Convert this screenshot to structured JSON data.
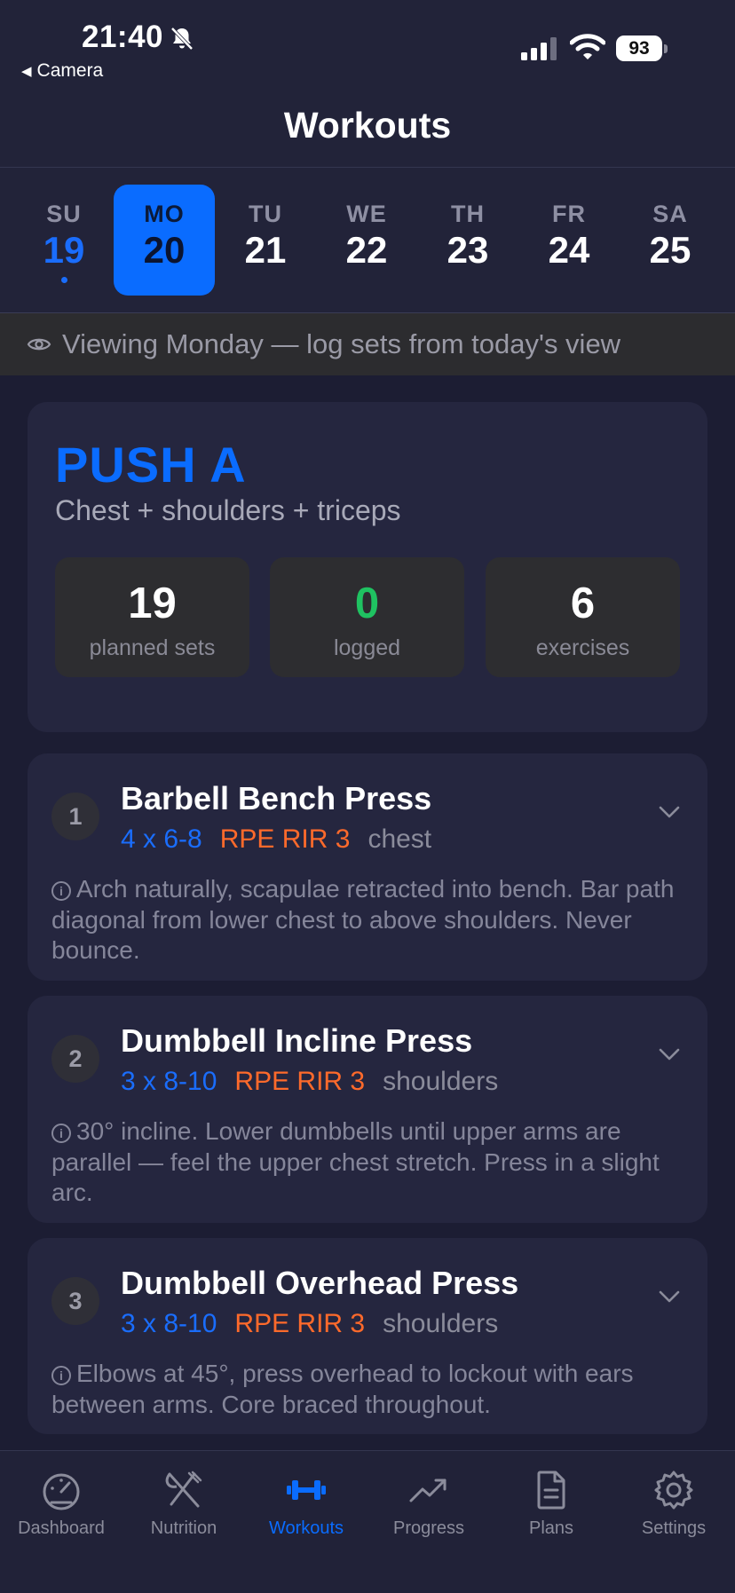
{
  "status_bar": {
    "time": "21:40",
    "back_app": "Camera",
    "battery": "93"
  },
  "header": {
    "title": "Workouts"
  },
  "week": {
    "days": [
      {
        "name": "SU",
        "date": "19",
        "state": "today"
      },
      {
        "name": "MO",
        "date": "20",
        "state": "selected"
      },
      {
        "name": "TU",
        "date": "21",
        "state": "normal"
      },
      {
        "name": "WE",
        "date": "22",
        "state": "normal"
      },
      {
        "name": "TH",
        "date": "23",
        "state": "normal"
      },
      {
        "name": "FR",
        "date": "24",
        "state": "normal"
      },
      {
        "name": "SA",
        "date": "25",
        "state": "normal"
      }
    ]
  },
  "banner": {
    "text": "Viewing Monday — log sets from today's view",
    "icon": "eye-icon"
  },
  "summary": {
    "title": "PUSH A",
    "subtitle": "Chest + shoulders + triceps",
    "stats": [
      {
        "value": "19",
        "label": "planned sets"
      },
      {
        "value": "0",
        "label": "logged"
      },
      {
        "value": "6",
        "label": "exercises"
      }
    ]
  },
  "exercises": [
    {
      "number": "1",
      "name": "Barbell Bench Press",
      "sets_reps": "4 x 6-8",
      "rpe": "RPE RIR 3",
      "muscle": "chest",
      "note": "Arch naturally, scapulae retracted into bench. Bar path diagonal from lower chest to above shoulders. Never bounce."
    },
    {
      "number": "2",
      "name": "Dumbbell Incline Press",
      "sets_reps": "3 x 8-10",
      "rpe": "RPE RIR 3",
      "muscle": "shoulders",
      "note": "30° incline. Lower dumbbells until upper arms are parallel — feel the upper chest stretch. Press in a slight arc."
    },
    {
      "number": "3",
      "name": "Dumbbell Overhead Press",
      "sets_reps": "3 x 8-10",
      "rpe": "RPE RIR 3",
      "muscle": "shoulders",
      "note": "Elbows at 45°, press overhead to lockout with ears between arms. Core braced throughout."
    }
  ],
  "tabbar": {
    "tabs": [
      {
        "label": "Dashboard",
        "icon": "gauge-icon"
      },
      {
        "label": "Nutrition",
        "icon": "fork-knife-icon"
      },
      {
        "label": "Workouts",
        "icon": "dumbbell-icon",
        "active": true
      },
      {
        "label": "Progress",
        "icon": "trend-up-icon"
      },
      {
        "label": "Plans",
        "icon": "document-icon"
      },
      {
        "label": "Settings",
        "icon": "gear-icon"
      }
    ]
  },
  "colors": {
    "accent": "#0a6cff",
    "success": "#1fc261",
    "rpe": "#ff6a2b",
    "background": "#1c1d33",
    "card": "#25263f"
  }
}
